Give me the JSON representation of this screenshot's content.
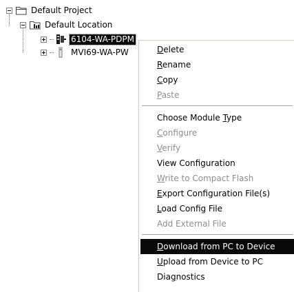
{
  "tree": {
    "project": {
      "label": "Default Project",
      "icon": "folder-icon",
      "expanded": true
    },
    "location": {
      "label": "Default Location",
      "icon": "location-folder-icon",
      "expanded": true
    },
    "modules": [
      {
        "label": "6104-WA-PDPM",
        "icon": "module-icon",
        "selected": true,
        "expanded": false
      },
      {
        "label": "MVI69-WA-PW",
        "icon": "module-icon",
        "selected": false,
        "expanded": false
      }
    ]
  },
  "menu": {
    "items": [
      {
        "label": "Delete",
        "mnemonic": "D",
        "enabled": true
      },
      {
        "label": "Rename",
        "mnemonic": "R",
        "enabled": true
      },
      {
        "label": "Copy",
        "mnemonic": "C",
        "enabled": true
      },
      {
        "label": "Paste",
        "mnemonic": "P",
        "enabled": false
      },
      {
        "separator": true
      },
      {
        "label": "Choose Module Type",
        "mnemonic": "T",
        "enabled": true
      },
      {
        "label": "Configure",
        "mnemonic": "C",
        "enabled": false
      },
      {
        "label": "Verify",
        "mnemonic": "V",
        "enabled": false
      },
      {
        "label": "View Configuration",
        "mnemonic": "",
        "enabled": true
      },
      {
        "label": "Write to Compact Flash",
        "mnemonic": "W",
        "enabled": false
      },
      {
        "label": "Export Configuration File(s)",
        "mnemonic": "E",
        "enabled": true
      },
      {
        "label": "Load Config File",
        "mnemonic": "L",
        "enabled": true
      },
      {
        "label": "Add External File",
        "mnemonic": "",
        "enabled": false
      },
      {
        "separator": true
      },
      {
        "label": "Download from PC to Device",
        "mnemonic": "D",
        "enabled": true,
        "highlighted": true
      },
      {
        "label": "Upload from Device to PC",
        "mnemonic": "U",
        "enabled": true
      },
      {
        "label": "Diagnostics",
        "mnemonic": "g",
        "enabled": true
      }
    ]
  },
  "colors": {
    "selection": "#0a0a0a",
    "selection_text": "#ffffff",
    "disabled_text": "#8e8e8e"
  }
}
